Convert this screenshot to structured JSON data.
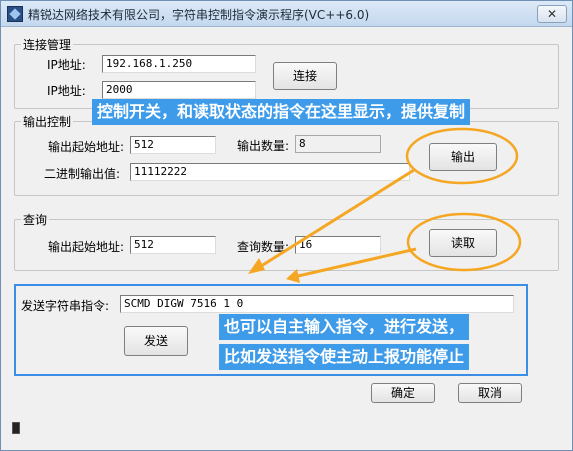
{
  "window": {
    "title": "精锐达网络技术有限公司，字符串控制指令演示程序(VC++6.0)",
    "close_label": "✕"
  },
  "connection": {
    "group_title": "连接管理",
    "ip_label": "IP地址:",
    "ip_value": "192.168.1.250",
    "port_label": "IP地址:",
    "port_value": "2000",
    "connect_label": "连接"
  },
  "output": {
    "group_title": "输出控制",
    "start_label": "输出起始地址:",
    "start_value": "512",
    "count_label": "输出数量:",
    "count_value": "8",
    "binary_label": "二进制输出值:",
    "binary_value": "11112222",
    "output_button": "输出"
  },
  "query": {
    "group_title": "查询",
    "start_label": "输出起始地址:",
    "start_value": "512",
    "count_label": "查询数量:",
    "count_value": "16",
    "read_button": "读取"
  },
  "send": {
    "command_label": "发送字符串指令:",
    "command_value": "SCMD DIGW 7516 1 0",
    "send_button": "发送"
  },
  "footer": {
    "ok_label": "确定",
    "cancel_label": "取消"
  },
  "annotations": {
    "top_callout": "控制开关，和读取状态的指令在这里显示，提供复制",
    "send_callout_line1": "也可以自主输入指令，进行发送，",
    "send_callout_line2": "比如发送指令使主动上报功能停止",
    "callout_bg": "#3d9bea",
    "highlight_color": "#f5a623",
    "send_box_color": "#3a8ee6"
  }
}
